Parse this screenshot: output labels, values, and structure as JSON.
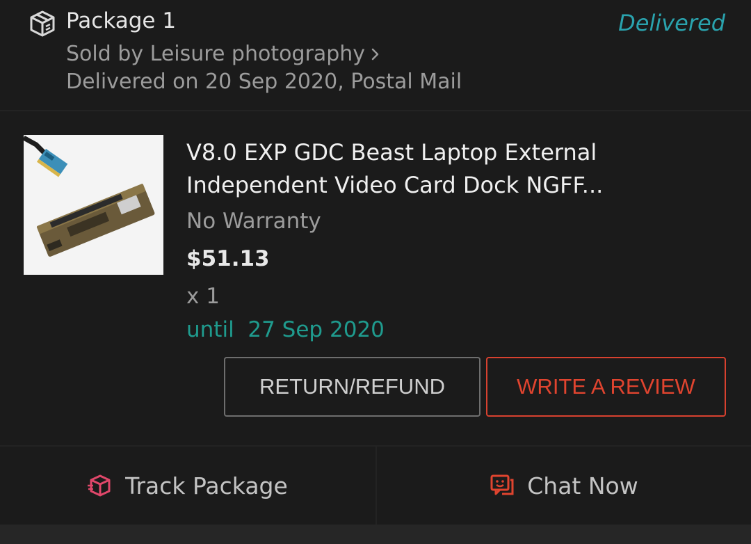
{
  "colors": {
    "background": "#1b1b1b",
    "status_teal": "#2aa3ae",
    "until_green": "#1f9b8e",
    "review_red": "#e0442f",
    "track_icon_pink": "#e0476a",
    "chat_icon_orange": "#e0442f"
  },
  "package": {
    "icon": "package-box-icon",
    "title": "Package 1",
    "status": "Delivered",
    "seller": "Sold by Leisure photography",
    "delivery": "Delivered on 20 Sep 2020, Postal Mail"
  },
  "item": {
    "title": "V8.0 EXP GDC Beast Laptop External Independent Video Card Dock NGFF...",
    "warranty": "No Warranty",
    "price": "$51.13",
    "quantity": "x 1",
    "until_label": "until  27 Sep 2020"
  },
  "buttons": {
    "return_refund": "RETURN/REFUND",
    "write_review": "WRITE A REVIEW"
  },
  "actions": {
    "track_label": "Track Package",
    "track_icon": "track-package-icon",
    "chat_label": "Chat Now",
    "chat_icon": "chat-icon"
  }
}
